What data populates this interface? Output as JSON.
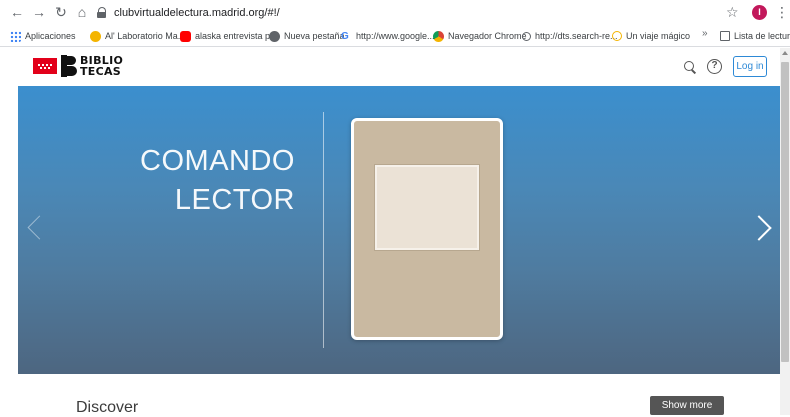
{
  "browser": {
    "url": "clubvirtualdelectura.madrid.org/#!/",
    "avatar_letter": "I",
    "back_icon": "arrow-left-icon",
    "forward_icon": "arrow-right-icon",
    "reload_icon": "reload-icon",
    "home_icon": "home-icon",
    "bookmarks": [
      {
        "label": "Aplicaciones",
        "icon": "apps-grid-icon",
        "color": "#4285f4"
      },
      {
        "label": "Al' Laboratorio Ma...",
        "icon": "site-icon",
        "color": "#f4b400"
      },
      {
        "label": "alaska entrevista pi...",
        "icon": "youtube-icon",
        "color": "#ff0000"
      },
      {
        "label": "Nueva pestaña",
        "icon": "globe-icon",
        "color": "#5f6368"
      },
      {
        "label": "http://www.google....",
        "icon": "google-icon",
        "color": "#4285f4"
      },
      {
        "label": "Navegador Chrome",
        "icon": "chrome-icon",
        "color": "#db4437"
      },
      {
        "label": "http://dts.search-re...",
        "icon": "search-icon",
        "color": "#5f6368"
      },
      {
        "label": "Un viaje mágico",
        "icon": "circle-icon",
        "color": "#f4b400"
      }
    ],
    "more_label": "»",
    "reading_list_label": "Lista de lectura"
  },
  "header": {
    "logo_line1": "BIBLIO",
    "logo_line2": "TECAS",
    "help_symbol": "?",
    "login_label": "Log in",
    "brand_color": "#e2001a",
    "accent_color": "#2d89d6"
  },
  "hero": {
    "title_line1": "COMANDO",
    "title_line2": "LECTOR",
    "book_color": "#c9b9a1"
  },
  "discover": {
    "title": "Discover",
    "show_more_label": "Show more"
  }
}
